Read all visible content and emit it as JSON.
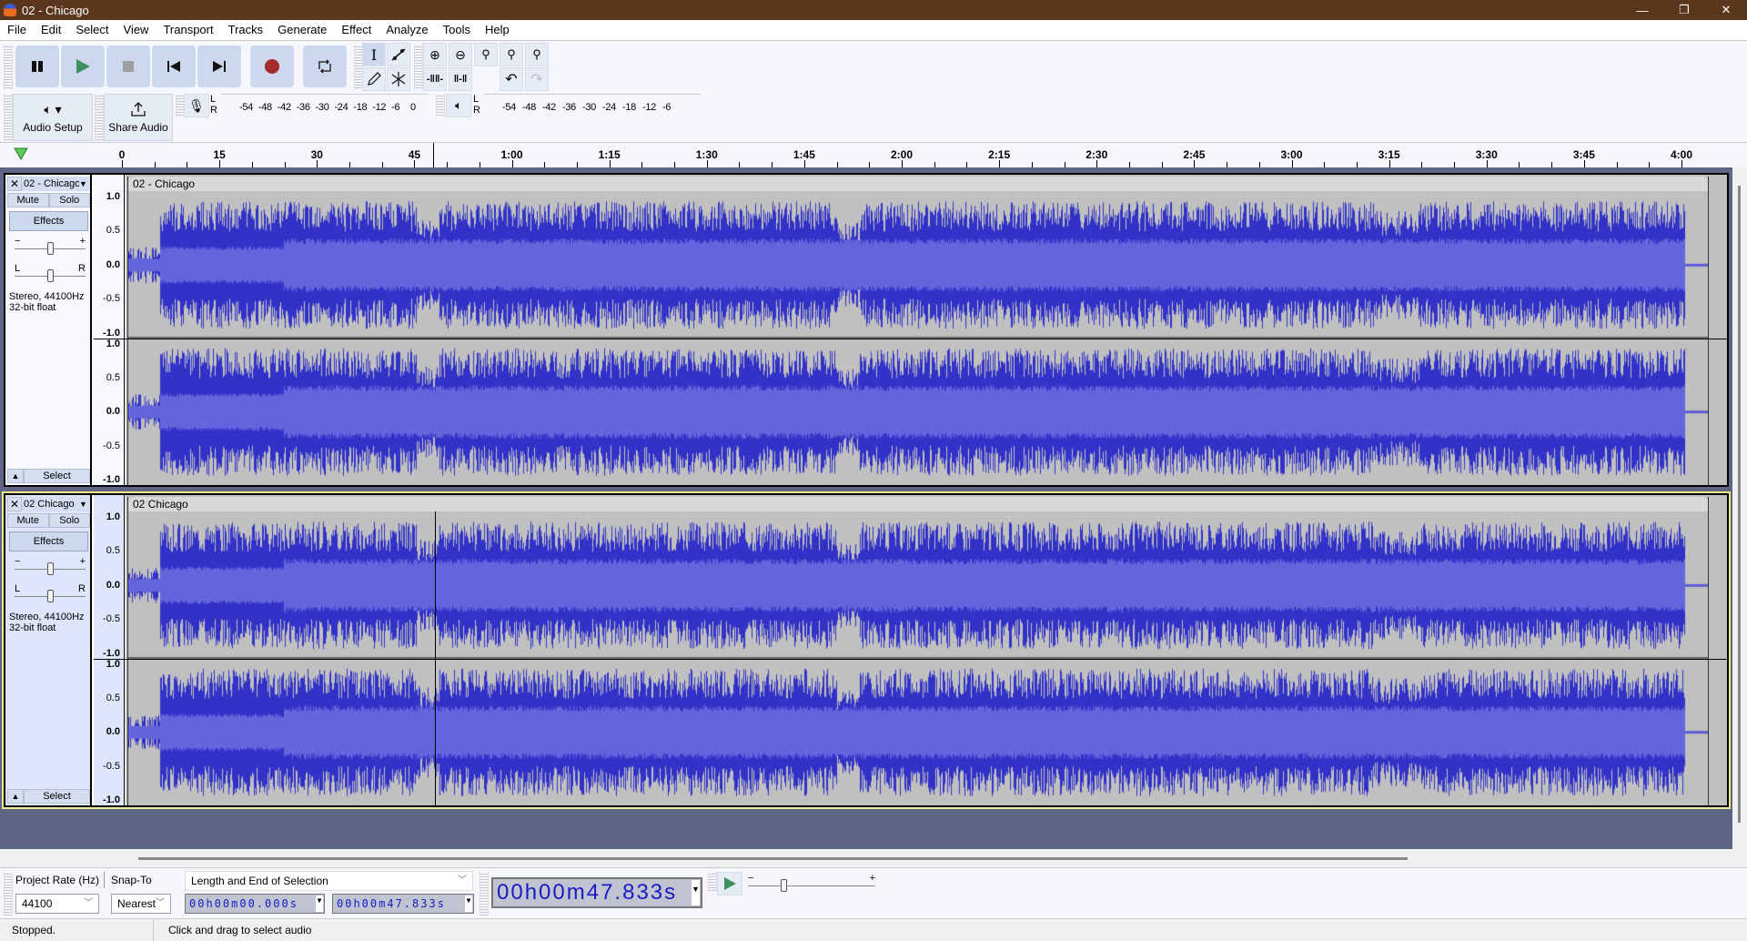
{
  "window": {
    "title": "02 - Chicago",
    "controls": {
      "minimize": "—",
      "maximize": "❐",
      "close": "✕"
    }
  },
  "menu": [
    "File",
    "Edit",
    "Select",
    "View",
    "Transport",
    "Tracks",
    "Generate",
    "Effect",
    "Analyze",
    "Tools",
    "Help"
  ],
  "transport": {
    "buttons": [
      {
        "name": "pause",
        "icon": "pause-icon"
      },
      {
        "name": "play",
        "icon": "play-icon"
      },
      {
        "name": "stop",
        "icon": "stop-icon"
      },
      {
        "name": "skip-start",
        "icon": "skip-start-icon"
      },
      {
        "name": "skip-end",
        "icon": "skip-end-icon"
      },
      {
        "name": "record",
        "icon": "record-icon"
      },
      {
        "name": "loop",
        "icon": "loop-icon"
      }
    ],
    "colors": {
      "play": "#3f8f5f",
      "record": "#a52a2a",
      "stop": "#a0a0a0"
    }
  },
  "tools": [
    "selection-tool",
    "envelope-tool",
    "draw-tool",
    "multi-tool"
  ],
  "edit_tools": [
    "zoom-in",
    "zoom-out",
    "fit-selection",
    "fit-project",
    "zoom-toggle",
    "trim-outside",
    "silence-selection",
    "undo",
    "redo"
  ],
  "audio_setup": {
    "label": "Audio Setup"
  },
  "share_audio": {
    "label": "Share Audio"
  },
  "record_meter": {
    "l": "L",
    "r": "R",
    "ticks": [
      "-54",
      "-48",
      "-42",
      "-36",
      "-30",
      "-24",
      "-18",
      "-12",
      "-6",
      "0"
    ]
  },
  "play_meter": {
    "l": "L",
    "r": "R",
    "ticks": [
      "-54",
      "-48",
      "-42",
      "-36",
      "-30",
      "-24",
      "-18",
      "-12",
      "-6"
    ]
  },
  "timeline": {
    "labels": [
      "0",
      "15",
      "30",
      "45",
      "1:00",
      "1:15",
      "1:30",
      "1:45",
      "2:00",
      "2:15",
      "2:30",
      "2:45",
      "3:00",
      "3:15",
      "3:30",
      "3:45",
      "4:00"
    ],
    "max_seconds": 240,
    "cursor_seconds": 47.833
  },
  "tracks": [
    {
      "name": "02 - Chicago",
      "clip_name": "02 - Chicago",
      "selected": false,
      "mute": "Mute",
      "solo": "Solo",
      "effects": "Effects",
      "gain": {
        "minus": "−",
        "plus": "+",
        "value": 0.5
      },
      "pan": {
        "left": "L",
        "right": "R",
        "value": 0.5
      },
      "info1": "Stereo, 44100Hz",
      "info2": "32-bit float",
      "select": "Select",
      "scale": [
        "1.0",
        "0.5",
        "0.0",
        "-0.5",
        "-1.0"
      ]
    },
    {
      "name": "02 Chicago",
      "clip_name": "02 Chicago",
      "selected": true,
      "mute": "Mute",
      "solo": "Solo",
      "effects": "Effects",
      "gain": {
        "minus": "−",
        "plus": "+",
        "value": 0.5
      },
      "pan": {
        "left": "L",
        "right": "R",
        "value": 0.5
      },
      "info1": "Stereo, 44100Hz",
      "info2": "32-bit float",
      "select": "Select",
      "scale": [
        "1.0",
        "0.5",
        "0.0",
        "-0.5",
        "-1.0"
      ]
    }
  ],
  "waveform_colors": {
    "outer": "#3232c8",
    "rms": "#6464dc",
    "bg": "#c0c0c0"
  },
  "bottom": {
    "project_rate_label": "Project Rate (Hz)",
    "snap_to_label": "Snap-To",
    "project_rate_value": "44100",
    "snap_to_value": "Nearest",
    "selection_mode": "Length and End of Selection",
    "selection_start": "00h00m00.000s",
    "selection_end": "00h00m47.833s",
    "audio_position": "00h00m47.833s",
    "play_at_speed": {
      "minus": "−",
      "plus": "+",
      "value": 0.5
    }
  },
  "status": {
    "state": "Stopped.",
    "hint": "Click and drag to select audio"
  }
}
